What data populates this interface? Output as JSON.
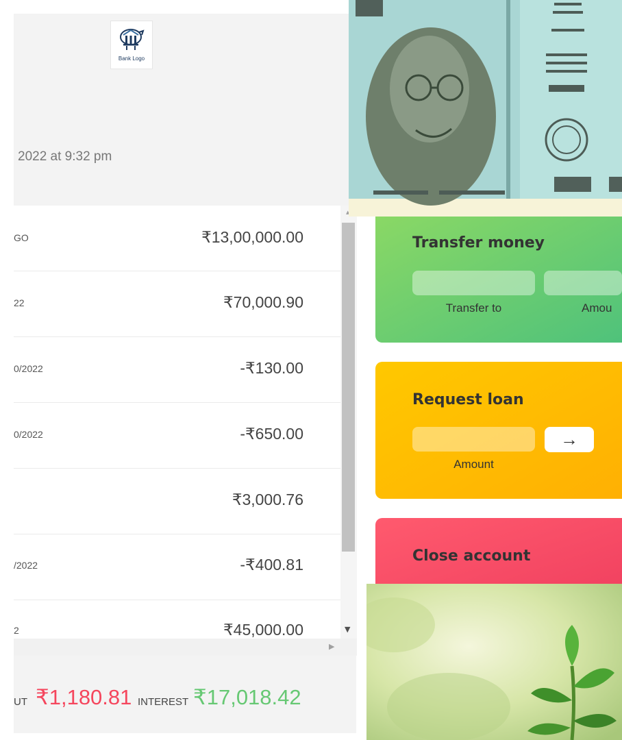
{
  "header": {
    "logo_text": "Bank Logo",
    "date_text": "2022 at 9:32 pm"
  },
  "movements": [
    {
      "date": "GO",
      "value": "₹13,00,000.00"
    },
    {
      "date": "22",
      "value": "₹70,000.90"
    },
    {
      "date": "0/2022",
      "value": "-₹130.00"
    },
    {
      "date": "0/2022",
      "value": "-₹650.00"
    },
    {
      "date": "",
      "value": "₹3,000.76"
    },
    {
      "date": "/2022",
      "value": "-₹400.81"
    },
    {
      "date": "2",
      "value": "₹45,000.00"
    }
  ],
  "summary": {
    "out_label": "UT",
    "out_value": "₹1,180.81",
    "interest_label": "INTEREST",
    "interest_value": "₹17,018.42"
  },
  "operations": {
    "transfer": {
      "title": "Transfer money",
      "to_label": "Transfer to",
      "amount_label": "Amou"
    },
    "loan": {
      "title": "Request loan",
      "amount_label": "Amount",
      "button": "→"
    },
    "close": {
      "title": "Close account"
    }
  },
  "colors": {
    "withdrawal": "#f5465d",
    "interest": "#66c873",
    "transfer_card": "#6fcf6a",
    "loan_card": "#ffbc00",
    "close_card": "#f5465d"
  },
  "icons": {
    "logo": "piggy-bank-icon",
    "scroll_up": "scroll-up-arrow",
    "scroll_down": "scroll-down-arrow",
    "scroll_right": "scroll-right-arrow"
  }
}
